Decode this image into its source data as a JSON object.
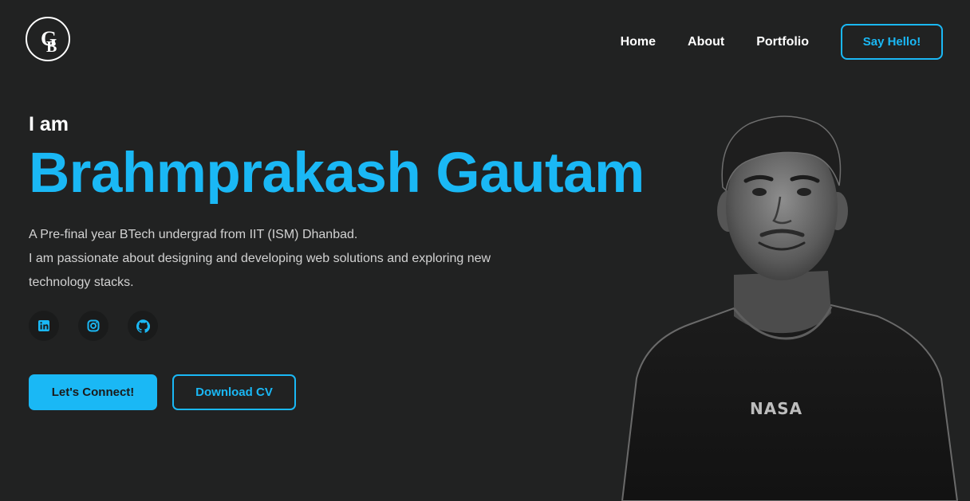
{
  "brand": {
    "logo_text": "GB"
  },
  "nav": {
    "items": [
      {
        "label": "Home"
      },
      {
        "label": "About"
      },
      {
        "label": "Portfolio"
      }
    ],
    "cta_label": "Say Hello!"
  },
  "hero": {
    "intro": "I am",
    "name": "Brahmprakash Gautam",
    "description_line1": "A Pre-final year BTech undergrad from IIT (ISM) Dhanbad.",
    "description_line2": "I am passionate about designing and developing web solutions and exploring new technology stacks.",
    "socials": [
      {
        "icon": "linkedin-icon"
      },
      {
        "icon": "instagram-icon"
      },
      {
        "icon": "github-icon"
      }
    ],
    "primary_button": "Let's Connect!",
    "secondary_button": "Download CV"
  },
  "portrait": {
    "shirt_text": "NASA"
  },
  "colors": {
    "accent": "#1ab8f5",
    "background": "#212222",
    "text": "#ffffff",
    "muted": "#d2d2d2"
  }
}
